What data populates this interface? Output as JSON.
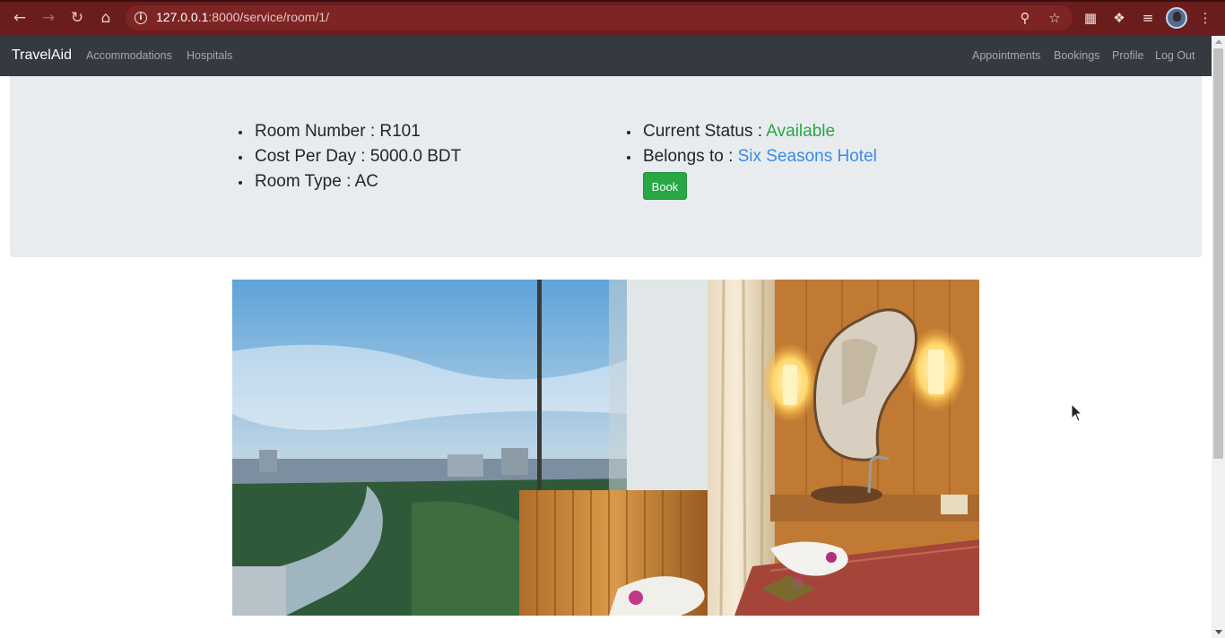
{
  "browser": {
    "url_host": "127.0.0.1",
    "url_rest": ":8000/service/room/1/",
    "icons": {
      "back": "back-arrow-icon",
      "forward": "forward-arrow-icon",
      "reload": "reload-icon",
      "home": "home-icon",
      "site_info": "info-icon",
      "zoom": "zoom-icon",
      "bookmark": "star-icon",
      "reading_list": "reading-list-icon",
      "extensions": "puzzle-icon",
      "media": "media-queue-icon",
      "menu": "kebab-menu-icon"
    },
    "colors": {
      "frame": "#6b1d1d",
      "omnibox": "#7d2424"
    }
  },
  "navbar": {
    "brand": "TravelAid",
    "left_links": [
      "Accommodations",
      "Hospitals"
    ],
    "right_links": [
      "Appointments",
      "Bookings",
      "Profile",
      "Log Out"
    ]
  },
  "room": {
    "number_label": "Room Number :",
    "number_value": "R101",
    "cost_label": "Cost Per Day :",
    "cost_value": "5000.0 BDT",
    "type_label": "Room Type :",
    "type_value": "AC",
    "status_label": "Current Status :",
    "status_value": "Available",
    "belongs_label": "Belongs to :",
    "belongs_value": "Six Seasons Hotel",
    "book_button": "Book"
  },
  "photo": {
    "subject": "hotel-room-photo"
  },
  "colors": {
    "navbar": "#343a40",
    "jumbotron": "#e9ecef",
    "success": "#28a745",
    "link": "#3a8ae6"
  }
}
